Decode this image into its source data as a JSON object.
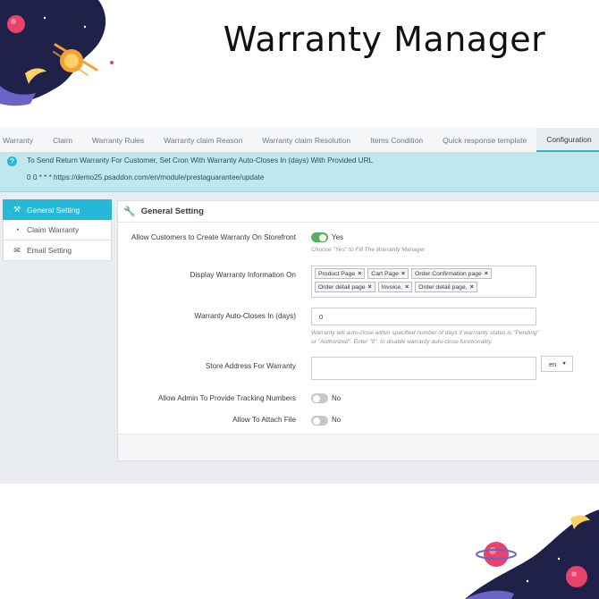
{
  "banner": {
    "title": "Warranty Manager"
  },
  "tabs": [
    {
      "label": "Warranty",
      "active": false
    },
    {
      "label": "Claim",
      "active": false
    },
    {
      "label": "Warranty Rules",
      "active": false
    },
    {
      "label": "Warranty claim Reason",
      "active": false
    },
    {
      "label": "Warranty claim Resolution",
      "active": false
    },
    {
      "label": "Items Condition",
      "active": false
    },
    {
      "label": "Quick response template",
      "active": false
    },
    {
      "label": "Configuration",
      "active": true
    }
  ],
  "info": {
    "line1": "To Send Return Warranty For Customer, Set Cron With Warranty Auto-Closes In (days) With Provided URL",
    "line2": "0 0 * * * https://demo25.psaddon.com/en/module/prestaguarantee/update"
  },
  "sidebar": {
    "items": [
      {
        "label": "General Setting",
        "icon": "tools-icon",
        "active": true
      },
      {
        "label": "Claim Warranty",
        "icon": "claim-icon",
        "active": false
      },
      {
        "label": "Email Setting",
        "icon": "email-icon",
        "active": false
      }
    ]
  },
  "panel": {
    "title": "General Setting",
    "allow_create": {
      "label": "Allow Customers to Create Warranty On Storefront",
      "value": "Yes",
      "on": true,
      "hint": "Choose \"Yes\" to Fill The Warranty Manager"
    },
    "display_on": {
      "label": "Display Warranty Information On",
      "tags": [
        "Product Page",
        "Cart Page",
        "Order Confirmation page",
        "Order detail page",
        "Invoice,",
        "Order detail page,"
      ]
    },
    "auto_close": {
      "label": "Warranty Auto-Closes In (days)",
      "value": "0",
      "hint": "Warranty will auto-close within specified number of days if warrranty status is \"Pending\" or \"Authorized\". Enter \"0\", to disable warranty auto-close functionality."
    },
    "store_address": {
      "label": "Store Address For Warranty",
      "value": "",
      "language": "en"
    },
    "tracking": {
      "label": "Allow Admin To Provide Tracking Numbers",
      "value": "No",
      "on": false
    },
    "attach": {
      "label": "Allow To Attach File",
      "value": "No",
      "on": false
    }
  },
  "colors": {
    "accent": "#25b9d7",
    "toggle_on": "#57b061",
    "info_bg": "#bfe7ee"
  }
}
